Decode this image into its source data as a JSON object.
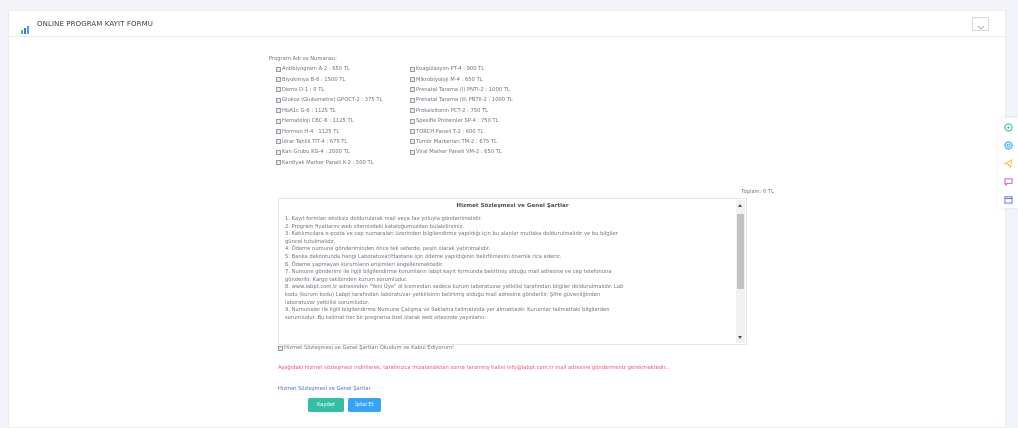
{
  "header": {
    "title": "ONLINE PROGRAM KAYIT FORMU",
    "chart_icon": "bar-chart-icon",
    "collapse_icon": "chevron-down-icon"
  },
  "programs": {
    "label": "Program Adı ve Numarası:",
    "left": [
      "Antibiyogram A-2 : 650 TL",
      "Biyokimya B-6 : 1500 TL",
      "Demo D-1 : 0 TL",
      "Glukoz (Glukometre) GPOCT-2 : 375 TL",
      "HbA1c G-6 : 1125 TL",
      "Hematoloji CBC-6 : 1125 TL",
      "Hormon H-4 : 1125 TL",
      "İdrar Tahlili TİT-4 : 675 TL",
      "Kan Grubu KG-4 : 2000 TL",
      "Kardiyak Marker Paneli K-2 : 500 TL"
    ],
    "right": [
      "Koagülasyon PT-4 : 900 TL",
      "Mikrobiyoloji M-4 : 650 TL",
      "Prenatal Tarama (I) PNTI-2 : 1000 TL",
      "Prenatal Tarama (II) PNTII-2 : 1000 TL",
      "Prokalsitonin PCT-2 : 750 TL",
      "Spesifik Proteinler SP-4 : 750 TL",
      "TORCH Paneli T-2 : 600 TL",
      "Tümör Markerları TM-2 : 675 TL",
      "Viral Marker Paneli VM-2 : 650 TL"
    ],
    "total": "Toplam: 0 TL"
  },
  "contract": {
    "title": "Hizmet Sözleşmesi ve Genel Şartlar",
    "items": [
      "1. Kayıt formları eksiksiz doldurularak mail veya fax yoluyla gönderilmelidir.",
      "2. Program fiyatlarını web sitemizdeki kataloğumuzdan bulabilirsiniz.",
      "3. Katılımcılara e-posta ve cep numaraları üzerinden bilgilendirme yapıldığı için bu alanlar mutlaka doldurulmalıdır ve bu bilgiler",
      "   güncel tutulmalıdır.",
      "4. Ödeme numune gönderiminden önce tek seferde, peşin olarak yatırılmalıdır.",
      "5. Banka dekontunda hangi Laboratuvar/Hastane için ödeme yapıldığının belirtilmesini önemle rica ederiz.",
      "6. Ödeme yapmayan kurumların erişimleri engellenmektedir.",
      "7. Numune gönderimi ile ilgili bilgilendirme kurumların labpt kayıt formunda belirtmiş olduğu mail adresine ve cep telefonuna",
      "   gönderilir. Kargo takibinden kurum sorumludur.",
      "8. www.labpt.com.tr adresinden \"Yeni Üye\" ol kısmından sadece kurum laboratuvar yetkilisi tarafından bilgiler doldurulmalıdır. Lab",
      "   kodu (kurum kodu) Labpt tarafından laboratuvar yetkilisinin belirtmiş olduğu mail adresine gönderilir. Şifre güvenliğinden",
      "   laboratuvar yetkilisi sorumludur.",
      "9. Numuneler ile ilgili bilgilendirme Numune Çalışma ve Saklama talimatında yer almaktadır. Kurumlar talimattaki bilgilerden",
      "   sorumludur. Bu talimat her bir programa özel olarak web sitesinde yayınlanır."
    ],
    "agree_label": "Hizmet Sözleşmesi ve Genel Şartları Okudum ve Kabul Ediyorum!"
  },
  "notice": {
    "warning": "Aşağıdaki hizmet sözleşmesi indirilerek, tarafınızca imzalandıktan sonra taranmış halini info@labpt.com.tr mail adresine göndermeniz gerekmektedir...",
    "link": "Hizmet Sözleşmesi ve Genel Şartlar"
  },
  "buttons": {
    "save": "Kaydet",
    "cancel": "İptal Et"
  },
  "side_tools": [
    "palette-icon",
    "life-ring-icon",
    "send-icon",
    "chat-icon",
    "calendar-icon"
  ],
  "colors": {
    "accent_green": "#34bfa3",
    "accent_blue": "#36a3f7",
    "warning_red": "#f4516c",
    "link_blue": "#5867dd"
  }
}
